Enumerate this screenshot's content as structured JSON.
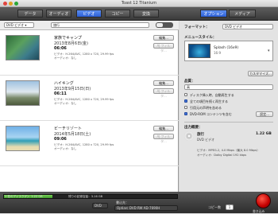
{
  "window": {
    "title": "Toast 12 Titanium"
  },
  "tabs": [
    {
      "label": "データ",
      "selected": false
    },
    {
      "label": "オーディオ",
      "selected": false
    },
    {
      "label": "ビデオ",
      "selected": true
    },
    {
      "label": "コピー",
      "selected": false
    },
    {
      "label": "変換",
      "selected": false
    }
  ],
  "right_tabs": [
    {
      "label": "オプション",
      "selected": true
    },
    {
      "label": "メディア",
      "selected": false
    }
  ],
  "source": {
    "format_select": "DVD ビデオ",
    "disc_name": "旅行"
  },
  "items": [
    {
      "title": "家族でキャンプ",
      "date": "2013年8月6日(金)",
      "duration": "06:06",
      "video": "ビデオ：H.264/AVC, 1280 x 720, 29.99 fps",
      "audio": "オーディオ：なし",
      "edit": "編集...",
      "filter": "AJ フィルタ..."
    },
    {
      "title": "ハイキング",
      "date": "2013年9月15日(日)",
      "duration": "06:11",
      "video": "ビデオ：H.264/AVC, 1280 x 720, 29.99 fps",
      "audio": "オーディオ：なし",
      "edit": "編集...",
      "filter": "AJ フィルタ..."
    },
    {
      "title": "ビーチリゾート",
      "date": "2014年5月18日(土)",
      "duration": "09:06",
      "video": "ビデオ：H.264/AVC, 1280 x 720, 29.99 fps",
      "audio": "オーディオ：なし",
      "edit": "編集...",
      "filter": "AJ フィルタ..."
    }
  ],
  "left_footer": {
    "summary": "3 項目 - 21:26"
  },
  "options": {
    "format_label": "フォーマット：",
    "format_value": "DVD ビデオ",
    "menu_style_label": "メニュースタイル：",
    "menu_style_name": "Splash (16x9)",
    "menu_style_sub": "16:9",
    "customize": "カスタマイズ...",
    "quality_label": "品質：",
    "quality_value": "高",
    "checks": [
      {
        "label": "ディスク挿入時、自動再生する",
        "on": false
      },
      {
        "label": "全ての項目を続く再生する",
        "on": true
      },
      {
        "label": "引用元の声明を含める",
        "on": false
      },
      {
        "label": "DVD-ROM コンテンツを含む",
        "on": true
      }
    ],
    "settings_button": "設定...",
    "output_label": "出力概要：",
    "output_title": "旅行",
    "output_size": "1.22 GB",
    "output_type": "DVD ビデオ",
    "output_video": "ビデオ：MPEG-2, 4.0 Mbps（最大 8.0 Mbps）",
    "output_audio": "オーディオ：Dolby Digital 192 kbps"
  },
  "bottom": {
    "disc_usage_label": "1 枚のディスク(F)：1.22 GB",
    "remaining_label": "残りの記録容量：3.16 GB",
    "disc_type": "DVD",
    "recorder_label": "書込先：",
    "recorder_value": "Optiarc DVD RW AD-7690H",
    "copies_label": "コピー数",
    "copies_value": "1",
    "burn_label": "書き込み",
    "usage_fraction": 0.28,
    "burn_color": "#c40000"
  }
}
